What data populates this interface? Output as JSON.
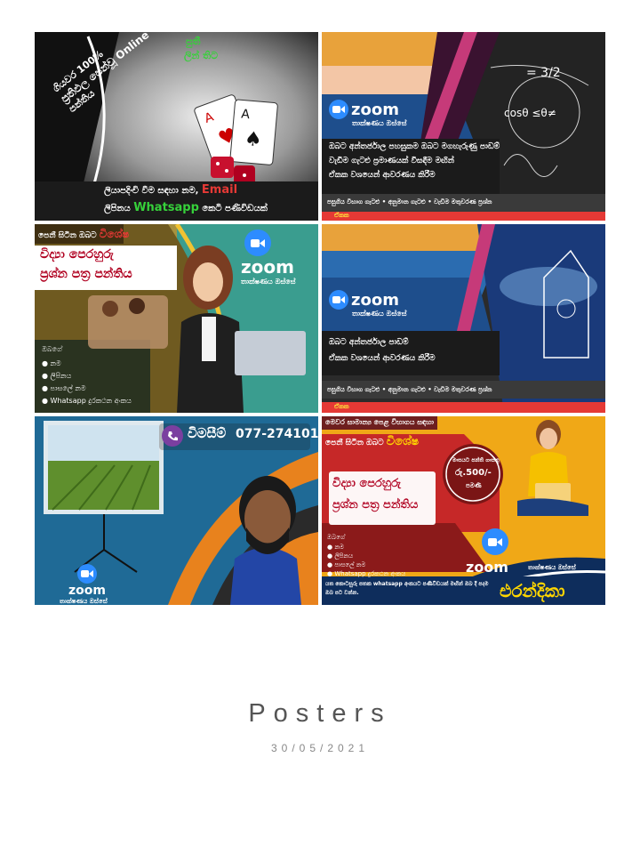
{
  "album": {
    "title": "Posters",
    "date": "30/05/2021"
  },
  "posters": [
    {
      "headline_top": "පුතී",
      "headline_top2": "ලින් තිට",
      "left_lines": [
        "ගියවර 100%",
        "ප්‍රතිඵල පෙන්වූ Online",
        "පන්තිය"
      ],
      "bottom_line1": "ලියාපදිංචි වීම සඳහා නම,",
      "bottom_email": "Email",
      "bottom_line2a": "ලිපිනය",
      "bottom_whatsapp": "Whatsapp",
      "bottom_line2b": "කෙටි පණිවිඩයක්"
    },
    {
      "zoom": "zoom",
      "zoom_sub": "තාක්ෂණය ඔස්සේ",
      "body_lines": [
        "ඔබට අන්තර්ජාල පහසුකම ඔබට මගහැරුණු පාඩම්",
        "වැඩිම ගැටළු ප්‍රමාණයක් විසඳීම මඟින්",
        "ඒකක වශයෙන් ආවරණය කිරීම"
      ],
      "footer": "පසුගිය විභාග ගැටළු • අනුමාන ගැටළු • වැඩිම මතුවරණ ප්‍රශ්න",
      "badge": "ඒකක"
    },
    {
      "tag": "පෙනී සිටින ඔබට",
      "tag_special": "විශේෂ",
      "title_lines": [
        "විද්‍යා පෙරහුරු",
        "ප්‍රශ්න පත්‍ර පන්තිය"
      ],
      "zoom": "zoom",
      "zoom_sub": "තාක්ෂණය ඔස්සේ",
      "list_head": "ඔබගේ",
      "list": [
        "නම",
        "ලිපිනය",
        "පාසලේ නම",
        "Whatsapp දුරකථන අංකය"
      ]
    },
    {
      "zoom": "zoom",
      "zoom_sub": "තාක්ෂණය ඔස්සේ",
      "body_lines": [
        "ඔබට අන්තර්ජාල පාඩම්",
        "ඒකක වශයෙන් ආවරණය කිරීම"
      ],
      "footer": "පසුගිය විභාග ගැටළු • අනුමාන ගැටළු • වැඩිම මතුවරණ ප්‍රශ්න",
      "badge": "ඒකක"
    },
    {
      "contact_label": "විමසීම්",
      "phone": "077-2741010",
      "zoom": "zoom",
      "zoom_sub": "තාක්ෂණය ඔස්සේ"
    },
    {
      "tag1": "මෙවර සාමාන්‍ය පෙළ විභාගය සඳහා",
      "tag2": "පෙනී සිටින ඔබට",
      "tag_special": "විශේෂ",
      "title_lines": [
        "විද්‍යා පෙරහුරු",
        "ප්‍රශ්න පත්‍ර පන්තිය"
      ],
      "price_lines": [
        "මාසයට පන්ති ගාස්තු",
        "රු.500/-",
        "පමණි"
      ],
      "list_head": "ඔබගේ",
      "list": [
        "නම",
        "ලිපිනය",
        "පාසලේ නම",
        "Whatsapp දුරකථන අංකය"
      ],
      "zoom": "zoom",
      "zoom_sub": "තාක්ෂණය ඔස්සේ",
      "bottom_text": "යත කොටසුරු පතක whatsapp අංකයට පණිවිඩයක් මඟින් ඔබ දී පදම ඔබ පට වන්න.",
      "name": "එරන්දිකා"
    }
  ]
}
